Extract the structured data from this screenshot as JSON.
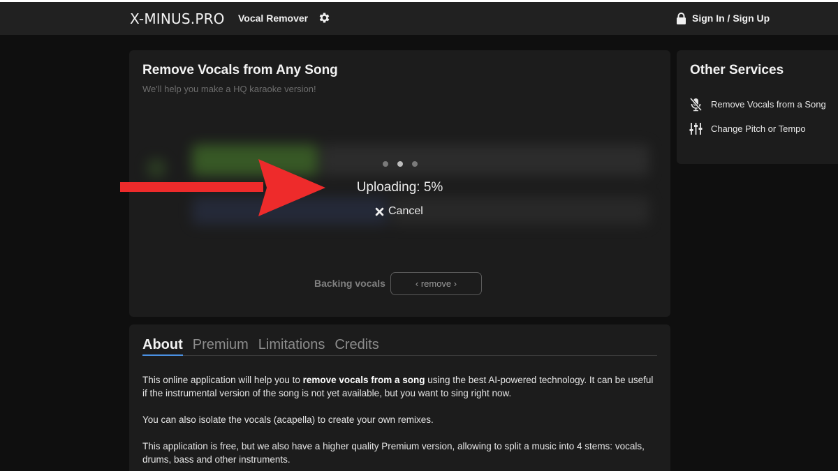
{
  "header": {
    "brand": "X-MINUS.PRO",
    "nav_link": "Vocal Remover",
    "settings_icon": "gear-icon",
    "signin_icon": "lock-icon",
    "signin_label": "Sign In / Sign Up"
  },
  "main": {
    "title": "Remove Vocals from Any Song",
    "subtitle": "We'll help you make a HQ karaoke version!",
    "upload_status": "Uploading: 5%",
    "upload_progress_percent": 5,
    "cancel_label": "Cancel",
    "backing_vocals_label": "Backing vocals",
    "backing_vocals_value": "‹ remove ›"
  },
  "side": {
    "title": "Other Services",
    "items": [
      {
        "label": "Remove Vocals from a Song",
        "icon": "muted-microphone-icon"
      },
      {
        "label": "Change Pitch or Tempo",
        "icon": "sliders-icon"
      }
    ]
  },
  "about": {
    "tabs": [
      "About",
      "Premium",
      "Limitations",
      "Credits"
    ],
    "active_tab": "About",
    "p1_before": "This online application will help you to ",
    "p1_bold": "remove vocals from a song",
    "p1_after": " using the best AI-powered technology. It can be useful if the instrumental version of the song is not yet available, but you want to sing right now.",
    "p2": "You can also isolate the vocals (acapella) to create your own remixes.",
    "p3": "This application is free, but we also have a higher quality Premium version, allowing to split a music into 4 stems: vocals, drums, bass and other instruments."
  },
  "colors": {
    "background": "#0f0f0f",
    "card": "#1c1c1c",
    "topbar": "#212121",
    "accent_tab": "#4a90e2",
    "arrow": "#ee2b2b"
  }
}
